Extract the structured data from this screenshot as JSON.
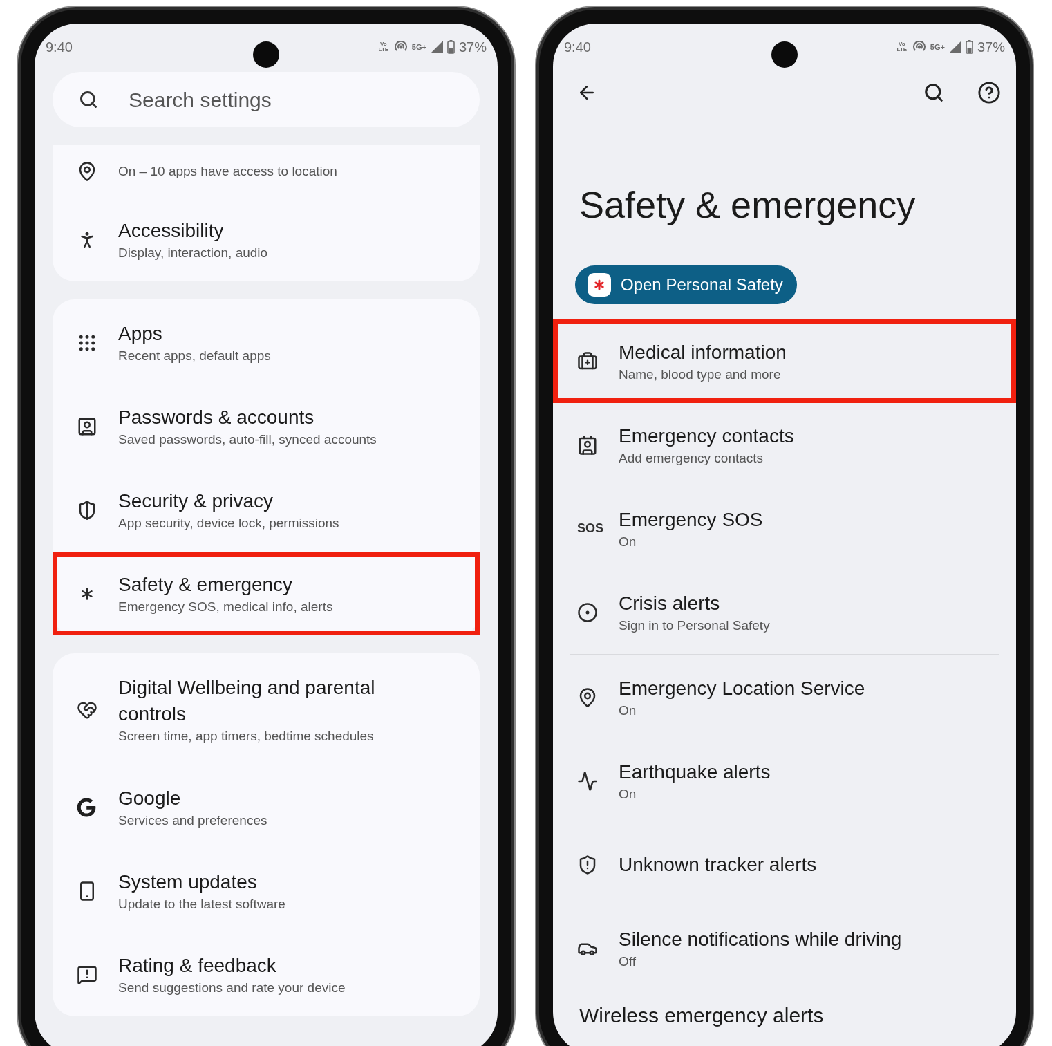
{
  "left_screen": {
    "status_bar": {
      "time": "9:40",
      "volte": "Vo LTE",
      "network": "5G+",
      "battery": "37%"
    },
    "search": {
      "placeholder": "Search settings"
    },
    "groups": [
      {
        "items": [
          {
            "subtitle": "On – 10 apps have access to location",
            "highlighted": false
          },
          {
            "title": "Accessibility",
            "subtitle": "Display, interaction, audio",
            "highlighted": false
          }
        ]
      },
      {
        "items": [
          {
            "title": "Apps",
            "subtitle": "Recent apps, default apps",
            "highlighted": false
          },
          {
            "title": "Passwords & accounts",
            "subtitle": "Saved passwords, auto-fill, synced accounts",
            "highlighted": false
          },
          {
            "title": "Security & privacy",
            "subtitle": "App security, device lock, permissions",
            "highlighted": false
          },
          {
            "title": "Safety & emergency",
            "subtitle": "Emergency SOS, medical info, alerts",
            "highlighted": true
          }
        ]
      },
      {
        "items": [
          {
            "title": "Digital Wellbeing and parental controls",
            "subtitle": "Screen time, app timers, bedtime schedules",
            "highlighted": false
          },
          {
            "title": "Google",
            "subtitle": "Services and preferences",
            "highlighted": false
          },
          {
            "title": "System updates",
            "subtitle": "Update to the latest software",
            "highlighted": false
          },
          {
            "title": "Rating & feedback",
            "subtitle": "Send suggestions and rate your device",
            "highlighted": false
          }
        ]
      }
    ]
  },
  "right_screen": {
    "status_bar": {
      "time": "9:40",
      "volte": "Vo LTE",
      "network": "5G+",
      "battery": "37%"
    },
    "title": "Safety & emergency",
    "action_button": "Open Personal Safety",
    "groups": [
      {
        "items": [
          {
            "title": "Medical information",
            "subtitle": "Name, blood type and more",
            "highlighted": true
          },
          {
            "title": "Emergency contacts",
            "subtitle": "Add emergency contacts",
            "highlighted": false
          },
          {
            "icon_text": "SOS",
            "title": "Emergency SOS",
            "subtitle": "On",
            "highlighted": false
          },
          {
            "title": "Crisis alerts",
            "subtitle": "Sign in to Personal Safety",
            "highlighted": false
          }
        ]
      },
      {
        "items": [
          {
            "title": "Emergency Location Service",
            "subtitle": "On",
            "highlighted": false
          },
          {
            "title": "Earthquake alerts",
            "subtitle": "On",
            "highlighted": false
          },
          {
            "title": "Unknown tracker alerts",
            "highlighted": false
          },
          {
            "title": "Silence notifications while driving",
            "subtitle": "Off",
            "highlighted": false
          }
        ]
      }
    ],
    "section_heading": "Wireless emergency alerts"
  }
}
